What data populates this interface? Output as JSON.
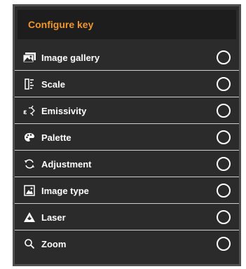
{
  "panel": {
    "title": "Configure key",
    "accent_color": "#f0962a"
  },
  "items": [
    {
      "label": "Image gallery",
      "icon": "image-gallery-icon",
      "selected": false
    },
    {
      "label": "Scale",
      "icon": "scale-icon",
      "selected": false
    },
    {
      "label": "Emissivity",
      "icon": "emissivity-icon",
      "selected": false
    },
    {
      "label": "Palette",
      "icon": "palette-icon",
      "selected": false
    },
    {
      "label": "Adjustment",
      "icon": "adjustment-icon",
      "selected": false
    },
    {
      "label": "Image type",
      "icon": "image-type-icon",
      "selected": false
    },
    {
      "label": "Laser",
      "icon": "laser-icon",
      "selected": false
    },
    {
      "label": "Zoom",
      "icon": "zoom-icon",
      "selected": false
    }
  ]
}
